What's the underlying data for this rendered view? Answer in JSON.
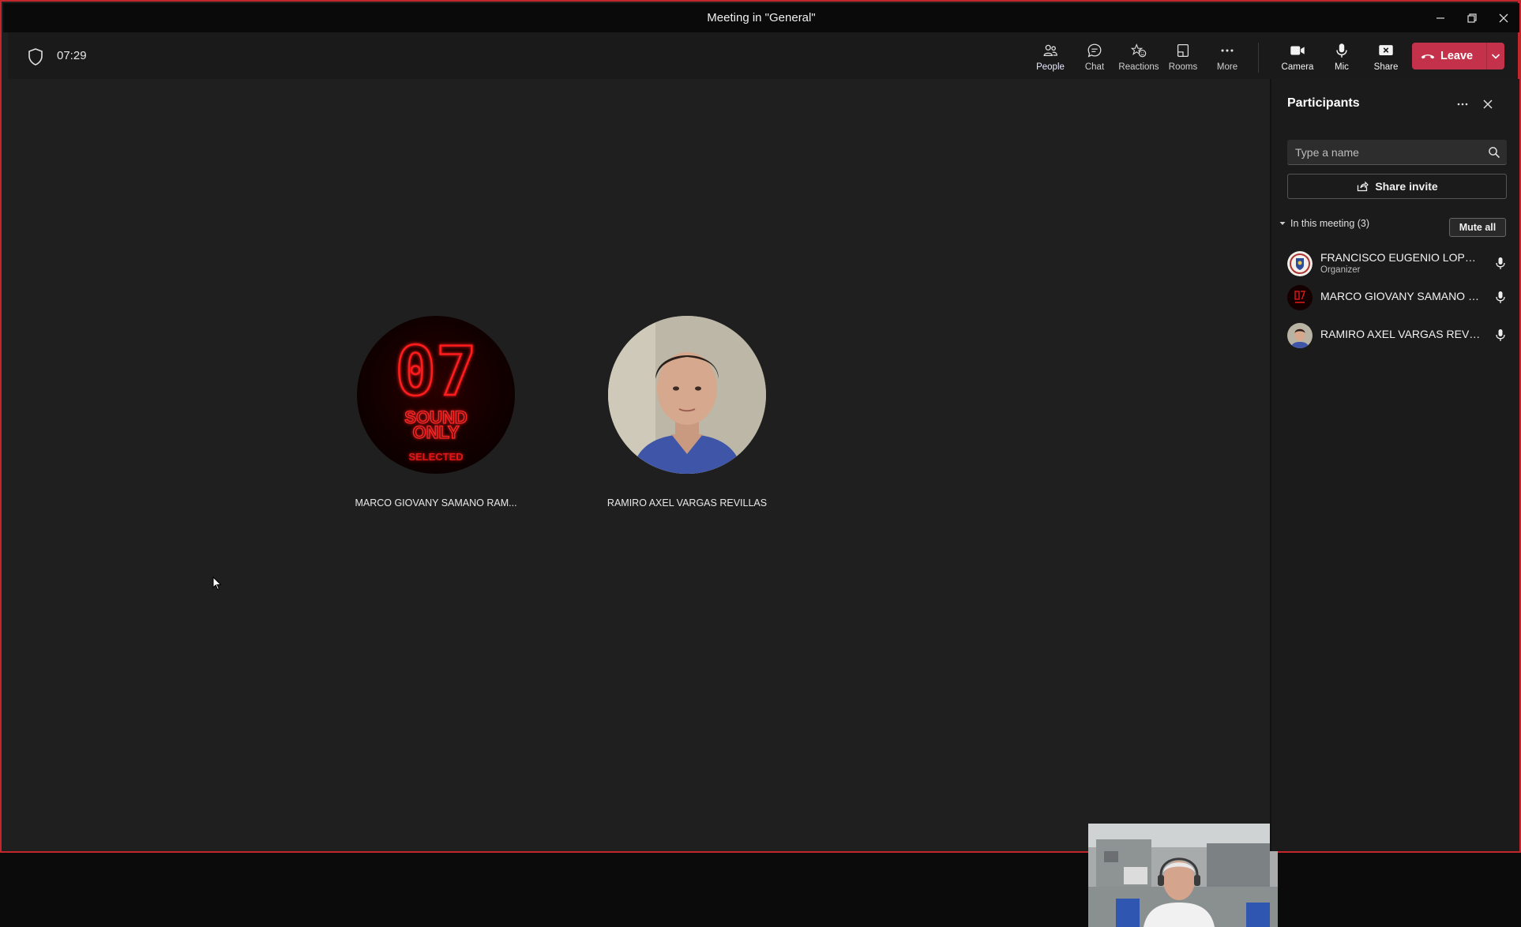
{
  "window": {
    "title": "Meeting in \"General\""
  },
  "toolbar": {
    "timer": "07:29",
    "tools": [
      {
        "label": "People",
        "icon": "people-icon"
      },
      {
        "label": "Chat",
        "icon": "chat-icon"
      },
      {
        "label": "Reactions",
        "icon": "reactions-icon"
      },
      {
        "label": "Rooms",
        "icon": "rooms-icon"
      },
      {
        "label": "More",
        "icon": "more-icon"
      }
    ],
    "controls": [
      {
        "label": "Camera",
        "icon": "camera-icon"
      },
      {
        "label": "Mic",
        "icon": "mic-icon"
      },
      {
        "label": "Share",
        "icon": "share-tray-icon"
      }
    ],
    "leave_label": "Leave"
  },
  "stage": {
    "tiles": [
      {
        "name": "MARCO GIOVANY SAMANO RAM...",
        "avatar_text": {
          "number": "07",
          "line1": "SOUND",
          "line2": "ONLY",
          "line3": "SELECTED"
        }
      },
      {
        "name": "RAMIRO AXEL VARGAS REVILLAS"
      }
    ]
  },
  "panel": {
    "title": "Participants",
    "search_placeholder": "Type a name",
    "share_invite_label": "Share invite",
    "section_label": "In this meeting (3)",
    "mute_all_label": "Mute all",
    "participants": [
      {
        "name": "FRANCISCO EUGENIO LOPEZ G...",
        "role": "Organizer"
      },
      {
        "name": "MARCO GIOVANY SAMANO RA..."
      },
      {
        "name": "RAMIRO AXEL VARGAS REVILLAS"
      }
    ]
  },
  "colors": {
    "accent": "#7f85f5",
    "leave": "#c4314b",
    "frame_border": "#c4262e",
    "background": "#1f1f1f"
  }
}
